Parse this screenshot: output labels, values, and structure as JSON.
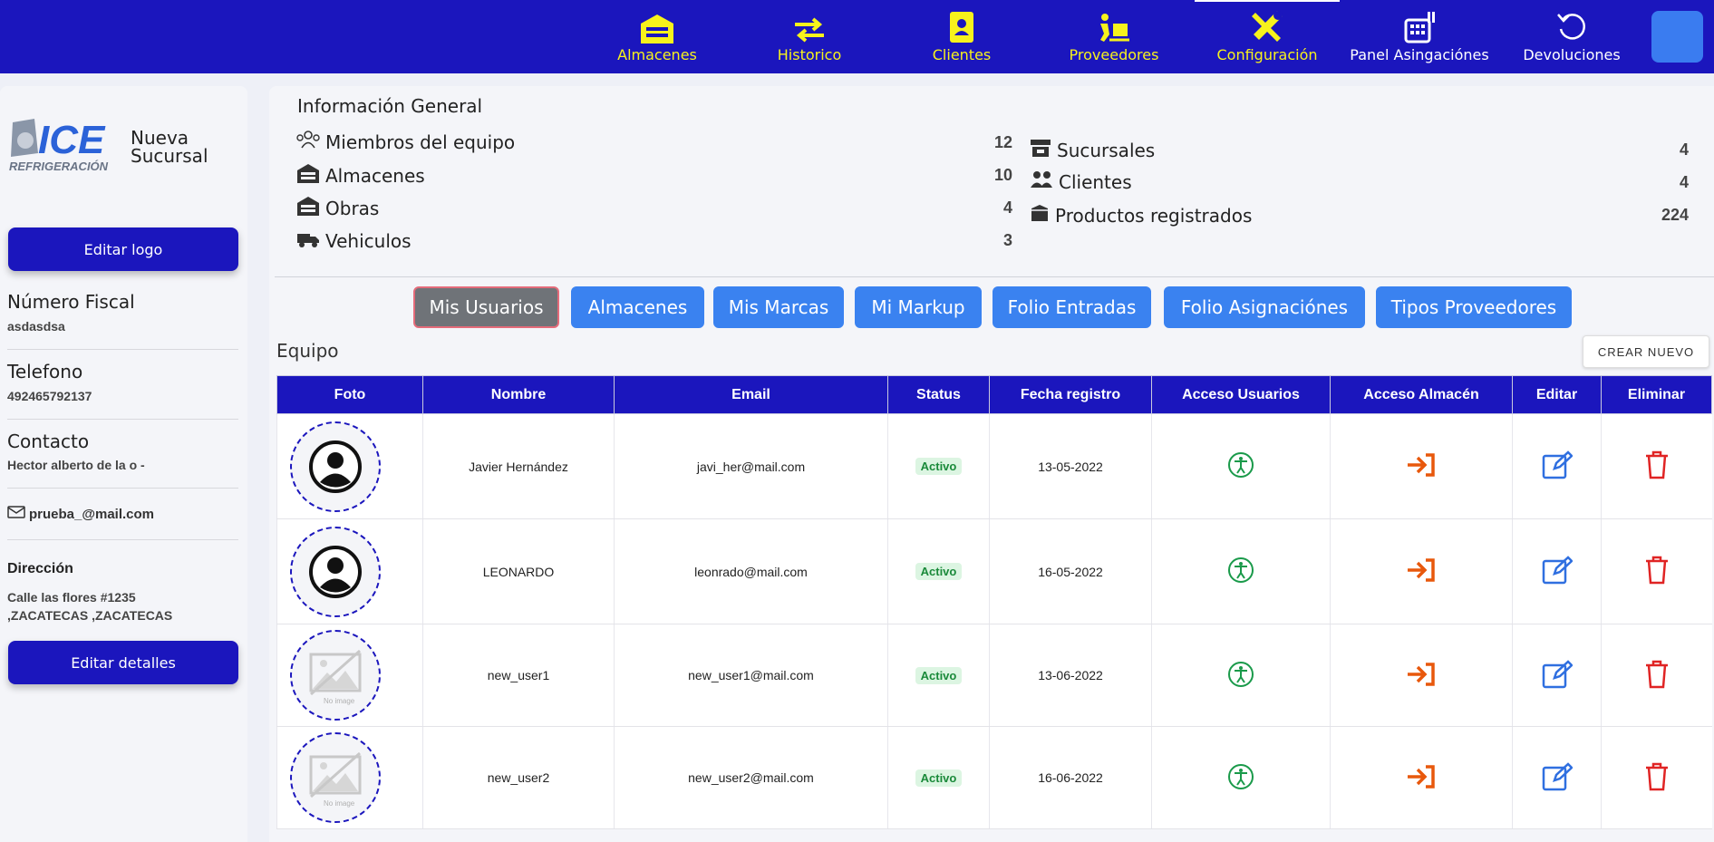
{
  "nav": {
    "items": [
      {
        "label": "Almacenes",
        "icon": "warehouse-icon"
      },
      {
        "label": "Historico",
        "icon": "exchange-arrows-icon"
      },
      {
        "label": "Clientes",
        "icon": "contact-book-icon"
      },
      {
        "label": "Proveedores",
        "icon": "dolly-icon"
      },
      {
        "label": "Configuración",
        "icon": "tools-icon"
      },
      {
        "label": "Panel Asingaciónes",
        "icon": "cash-register-icon"
      },
      {
        "label": "Devoluciones",
        "icon": "undo-icon"
      }
    ],
    "active": "Configuración"
  },
  "sidebar": {
    "logo_text": "ICE",
    "logo_subtext": "REFRIGERACIÓN",
    "branch_name": "Nueva Sucursal",
    "edit_logo_label": "Editar logo",
    "fiscal_label": "Número Fiscal",
    "fiscal_value": "asdasdsa",
    "phone_label": "Telefono",
    "phone_value": "492465792137",
    "contact_label": "Contacto",
    "contact_value": "Hector alberto de la o -",
    "email_value": "prueba_@mail.com",
    "address_label": "Dirección",
    "address_line1": "Calle las flores #1235",
    "address_line2": ",ZACATECAS ,ZACATECAS",
    "edit_details_label": "Editar detalles"
  },
  "info": {
    "title": "Información General",
    "left": [
      {
        "label": "Miembros del equipo",
        "value": "12",
        "icon": "team-icon"
      },
      {
        "label": "Almacenes",
        "value": "10",
        "icon": "warehouse-icon"
      },
      {
        "label": "Obras",
        "value": "4",
        "icon": "warehouse-icon"
      },
      {
        "label": "Vehiculos",
        "value": "3",
        "icon": "truck-icon"
      }
    ],
    "right": [
      {
        "label": "Sucursales",
        "value": "4",
        "icon": "store-icon"
      },
      {
        "label": "Clientes",
        "value": "4",
        "icon": "users-icon"
      },
      {
        "label": "Productos registrados",
        "value": "224",
        "icon": "box-icon"
      }
    ]
  },
  "tabs": [
    "Mis Usuarios",
    "Almacenes",
    "Mis Marcas",
    "Mi Markup",
    "Folio Entradas",
    "Folio Asignaciónes",
    "Tipos Proveedores"
  ],
  "team": {
    "title": "Equipo",
    "create_label": "CREAR NUEVO",
    "columns": [
      "Foto",
      "Nombre",
      "Email",
      "Status",
      "Fecha registro",
      "Acceso Usuarios",
      "Acceso Almacén",
      "Editar",
      "Eliminar"
    ],
    "rows": [
      {
        "name": "Javier Hernández",
        "email": "javi_her@mail.com",
        "status": "Activo",
        "date": "13-05-2022",
        "photo": "avatar"
      },
      {
        "name": "LEONARDO",
        "email": "leonrado@mail.com",
        "status": "Activo",
        "date": "16-05-2022",
        "photo": "avatar"
      },
      {
        "name": "new_user1",
        "email": "new_user1@mail.com",
        "status": "Activo",
        "date": "13-06-2022",
        "photo": "no-image",
        "no_image_text": "No image"
      },
      {
        "name": "new_user2",
        "email": "new_user2@mail.com",
        "status": "Activo",
        "date": "16-06-2022",
        "photo": "no-image",
        "no_image_text": "No image"
      }
    ]
  },
  "colors": {
    "primary": "#1b16bd",
    "accent": "#f7f21c",
    "tab": "#3a82f0",
    "green": "#1a9a4a",
    "orange": "#e8580c",
    "blue_icon": "#2f6fe0",
    "red": "#e02424"
  }
}
